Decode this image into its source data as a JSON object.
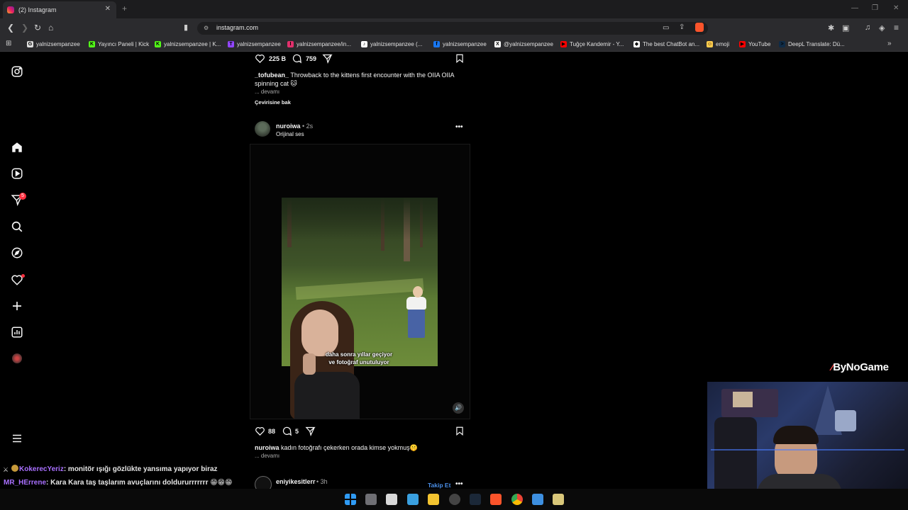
{
  "browser": {
    "tab_title": "(2) Instagram",
    "tab_close": "✕",
    "new_tab": "+",
    "url": "instagram.com",
    "window_controls": [
      "—",
      "❐",
      "✕"
    ],
    "bookmarks": [
      {
        "label": "yalnizsempanzee",
        "icon": "G",
        "color": "#dddddd"
      },
      {
        "label": "Yayıncı Paneli | Kick",
        "icon": "K",
        "color": "#53fc18"
      },
      {
        "label": "yalnizsempanzee | K...",
        "icon": "K",
        "color": "#53fc18"
      },
      {
        "label": "yalnizsempanzee",
        "icon": "T",
        "color": "#9146ff"
      },
      {
        "label": "yalnizsempanzee/in...",
        "icon": "I",
        "color": "#e1306c"
      },
      {
        "label": "yalnizsempanzee (...",
        "icon": "♪",
        "color": "#ffffff"
      },
      {
        "label": "yalnizsempanzee",
        "icon": "f",
        "color": "#1877f2"
      },
      {
        "label": "@yalnizsempanzee",
        "icon": "X",
        "color": "#ffffff"
      },
      {
        "label": "Tuğçe Kandemir - Y...",
        "icon": "▶",
        "color": "#ff0000"
      },
      {
        "label": "The best ChatBot an...",
        "icon": "◆",
        "color": "#ffffff"
      },
      {
        "label": "emoji",
        "icon": "☺",
        "color": "#ffcc4d"
      },
      {
        "label": "YouTube",
        "icon": "▶",
        "color": "#ff0000"
      },
      {
        "label": "DeepL Translate: Dü...",
        "icon": ">",
        "color": "#0f2b46"
      }
    ]
  },
  "sidebar": {
    "badge_count": "5"
  },
  "post1": {
    "likes": "225 B",
    "comments": "759",
    "username": "_tofubean_",
    "caption": " Throwback to the kittens first encounter with the OIIA OIIA spinning cat 🐱",
    "more": "... devamı",
    "translate": "Çevirisine bak"
  },
  "post2": {
    "username": "nuroiwa",
    "time": "• 2s",
    "audio": "Orijinal ses",
    "overlay_line1": "daha sonra yıllar geçiyor",
    "overlay_line2": "ve fotoğraf unutuluyor",
    "likes": "88",
    "comments": "5",
    "caption_user": "nuroiwa",
    "caption": " kadın fotoğrafı çekerken orada kimse yokmuş🤫",
    "more": "... devamı"
  },
  "post3": {
    "username": "eniyikesitlerr",
    "time": "• 3h",
    "follow": "Takip Et"
  },
  "chat": [
    {
      "user": "KokerecYeriz",
      "message": ": monitör ışığı gözlükte yansıma yapıyor biraz",
      "color": "#a970ff"
    },
    {
      "user": "MR_HErrene",
      "message": ": Kara Kara taş taşlarım avuçlarını doldururrrrrrr 😁😁😁",
      "color": "#a970ff"
    }
  ],
  "stream": {
    "logo": "ByNoGame"
  }
}
